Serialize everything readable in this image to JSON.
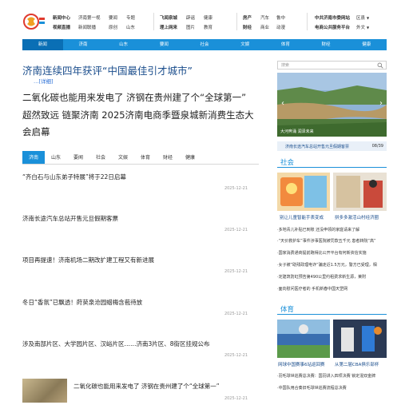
{
  "header": {
    "logo_alt": "舜网",
    "groups": [
      {
        "rows": [
          [
            "新闻中心",
            "济南第一视",
            "要闻",
            "专题"
          ],
          [
            "视频直播",
            "新闻联播",
            "原创",
            "山东"
          ]
        ]
      },
      {
        "rows": [
          [
            "飞闻泉城",
            "辟谣",
            "健康"
          ],
          [
            "理上网来",
            "图片",
            "教育"
          ]
        ]
      },
      {
        "rows": [
          [
            "房产",
            "汽车",
            "鲁中"
          ],
          [
            "财经",
            "商业",
            "动漫"
          ]
        ]
      },
      {
        "rows": [
          [
            "中共济南市委网站",
            "区县"
          ],
          [
            "电商公共服务平台",
            "外文"
          ]
        ]
      }
    ]
  },
  "nav": [
    "新闻",
    "济南",
    "山东",
    "要闻",
    "社会",
    "文娱",
    "体育",
    "财经",
    "健康"
  ],
  "main": {
    "headline": "济南连续四年获评“中国最佳引才城市”",
    "more_link": "…[详细]",
    "sub_headlines": [
      "二氧化碳也能用来发电了 济钢在贵州建了个“全球第一”",
      "超然致远 链聚济南 2025济南电商季暨泉城新消费生态大",
      "会启幕"
    ],
    "tabs": [
      "济南",
      "山东",
      "要闻",
      "社会",
      "文娱",
      "体育",
      "财经",
      "健康"
    ],
    "news": [
      {
        "title": "“齐白石与山东弟子特展”将于22日启幕",
        "time": "2025-12-21"
      },
      {
        "title": "济南长途汽车总站开售元旦假期客票",
        "time": "2025-12-21"
      },
      {
        "title": "项目再提速！济南机场二期改扩建工程又有新进展",
        "time": "2025-12-21"
      },
      {
        "title": "冬日“香氛”已飘透！莳荬泉沧园蜡梅含苞待放",
        "time": "2025-12-21"
      },
      {
        "title": "涉及南部片区、大学园片区、汉峪片区……济南3片区、8街区挂规公布",
        "time": "2025-12-21"
      }
    ],
    "thumb_news": {
      "title": "二氧化碳也能用来发电了 济钢在贵州建了个“全球第一”",
      "time": "2025-12-21"
    }
  },
  "sidebar": {
    "search_placeholder": "搜索",
    "slide": {
      "caption": "大河奔涌 润泽未来",
      "title": "济南长途汽车总站开售元旦假期客票",
      "pager": "08/39"
    },
    "social": {
      "title": "社会",
      "pics": [
        "别让儿童智能手表变成",
        "拼多多激活山村经济圈"
      ],
      "items": [
        "·多地青儿补贴已到账 还没申领的家庭请来了解",
        "·“天价救护车”事件涉事医院被罚款五千元 患者转院“高”",
        "·国家消费通商提前跑得比公开平台有何新资信实施",
        "·女子被“助残政理电诈”骗走近1.5万元，警方已受理，相",
        "·定建筑防虹预告第490公里约租费求新生源，莱附",
        "·面向慰问医疗者的 手机新春中国天罡网"
      ]
    },
    "sports": {
      "title": "体育",
      "pics": [
        "网球中国赛事6站巡回赛",
        "从第二届CBA俱乐部杯"
      ],
      "items": [
        "·羽毛球世巡赛总决赛：国羽讲入四项决赛 锁定混双金牌",
        "·中国队用合奏旧毛球世巡赛流程总决赛"
      ]
    }
  },
  "colors": {
    "brand_blue": "#1a90d9",
    "headline_blue": "#1a4d8c"
  }
}
